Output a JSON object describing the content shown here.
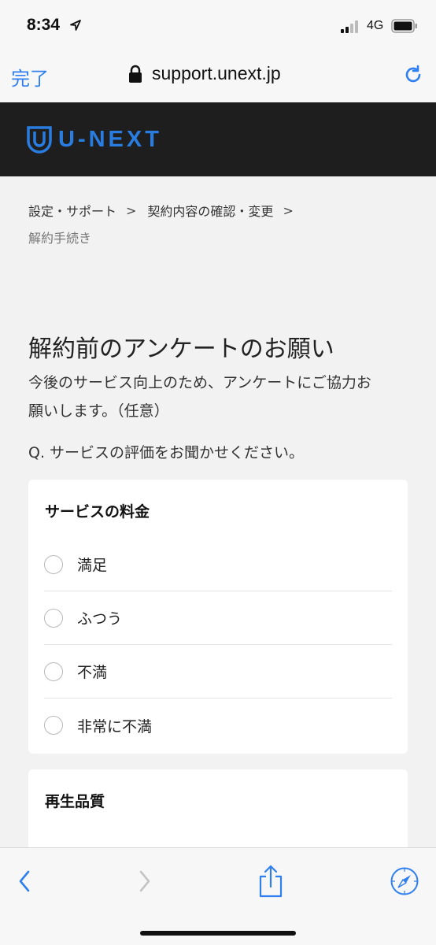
{
  "status_bar": {
    "time": "8:34",
    "network": "4G",
    "icons": [
      "location-arrow-icon",
      "signal-icon",
      "battery-icon"
    ]
  },
  "browser": {
    "done_label": "完了",
    "url": "support.unext.jp",
    "icons": [
      "lock-icon",
      "reload-icon"
    ],
    "accent_color": "#2f7ff0"
  },
  "header": {
    "logo_text": "U-NEXT",
    "logo_color": "#2a7de0",
    "background": "#1e1e1e"
  },
  "breadcrumb": {
    "items": [
      "設定・サポート",
      "契約内容の確認・変更"
    ],
    "separator": ">",
    "current": "解約手続き"
  },
  "main": {
    "title": "解約前のアンケートのお願い",
    "intro_line1": "今後のサービス向上のため、アンケートにご協力お",
    "intro_line2": "願いします。（任意）",
    "question": "Q. サービスの評価をお聞かせください。"
  },
  "cards": [
    {
      "title": "サービスの料金",
      "options": [
        "満足",
        "ふつう",
        "不満",
        "非常に不満"
      ]
    },
    {
      "title": "再生品質",
      "options": []
    }
  ],
  "toolbar": {
    "icons": [
      "back-icon",
      "forward-icon",
      "share-icon",
      "safari-compass-icon"
    ]
  }
}
